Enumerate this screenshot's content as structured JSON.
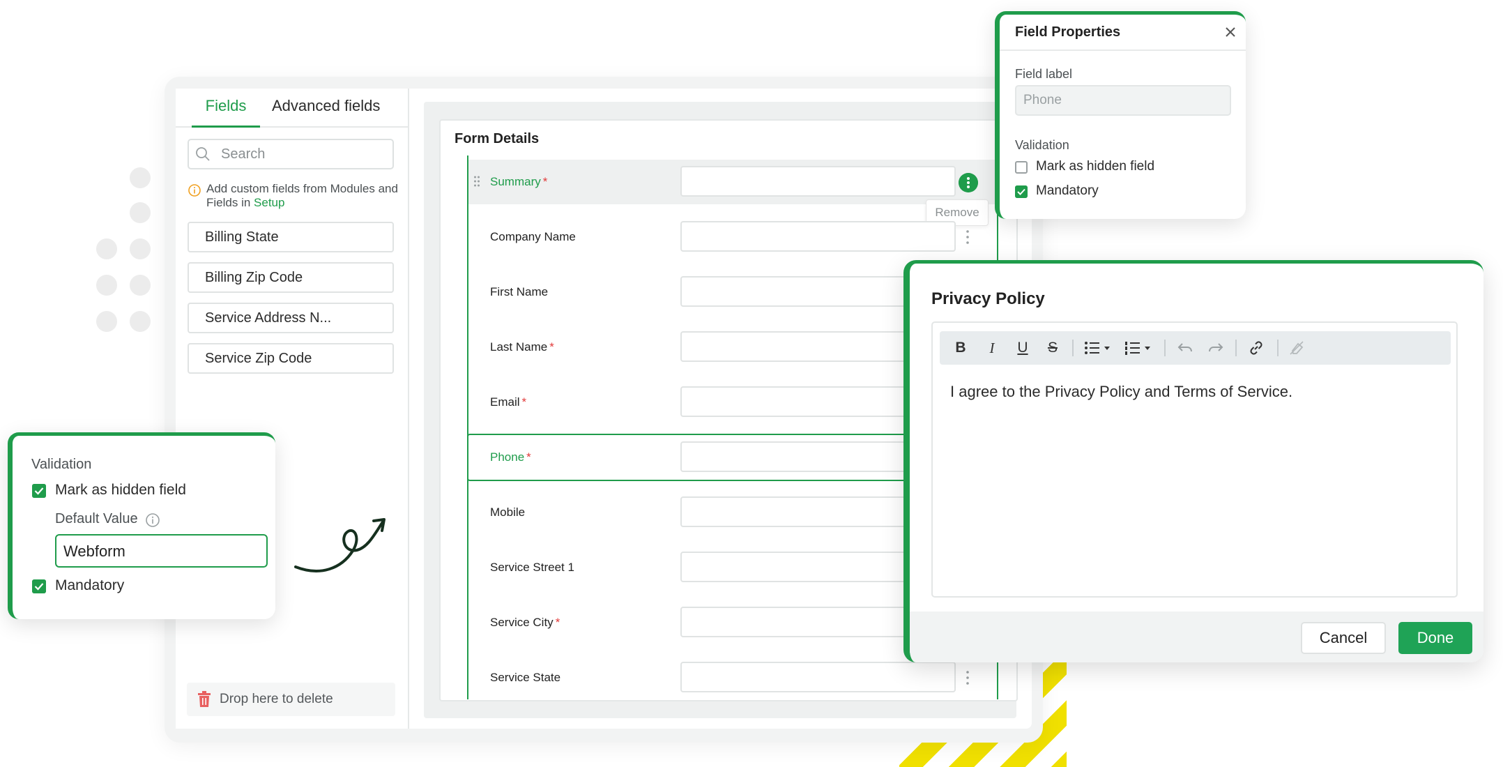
{
  "tabs": {
    "fields": "Fields",
    "advanced": "Advanced fields"
  },
  "search": {
    "placeholder": "Search"
  },
  "info_note": {
    "text": "Add custom fields from Modules and Fields in ",
    "link": "Setup"
  },
  "field_chips": [
    "Billing State",
    "Billing Zip Code",
    "Service Address N...",
    "Service Zip Code"
  ],
  "drop_zone": {
    "label": "Drop here to delete"
  },
  "form": {
    "title": "Form Details",
    "rows": [
      {
        "label": "Summary",
        "required": true
      },
      {
        "label": "Company Name",
        "required": false
      },
      {
        "label": "First Name",
        "required": false
      },
      {
        "label": "Last Name",
        "required": true
      },
      {
        "label": "Email",
        "required": true
      },
      {
        "label": "Phone",
        "required": true
      },
      {
        "label": "Mobile",
        "required": false
      },
      {
        "label": "Service Street 1",
        "required": false
      },
      {
        "label": "Service City",
        "required": true
      },
      {
        "label": "Service State",
        "required": false
      }
    ],
    "remove_tooltip": "Remove",
    "required_mark": "*"
  },
  "field_properties": {
    "title": "Field Properties",
    "field_label": "Field label",
    "field_value": "Phone",
    "validation": "Validation",
    "hidden_label": "Mark as hidden field",
    "hidden_checked": false,
    "mandatory_label": "Mandatory",
    "mandatory_checked": true
  },
  "validation_popup": {
    "title": "Validation",
    "hidden_label": "Mark as hidden field",
    "default_value_label": "Default Value",
    "default_value": "Webform",
    "mandatory_label": "Mandatory"
  },
  "privacy_policy": {
    "title": "Privacy Policy",
    "body": "I agree to the Privacy Policy and Terms of Service.",
    "cancel": "Cancel",
    "done": "Done",
    "toolbar": {
      "bold": "B",
      "italic": "I",
      "underline": "U",
      "strike": "S"
    }
  },
  "colors": {
    "accent": "#1f9c4b",
    "required": "#e23b3b",
    "done": "#1fa356",
    "stripe": "#f0e000"
  }
}
